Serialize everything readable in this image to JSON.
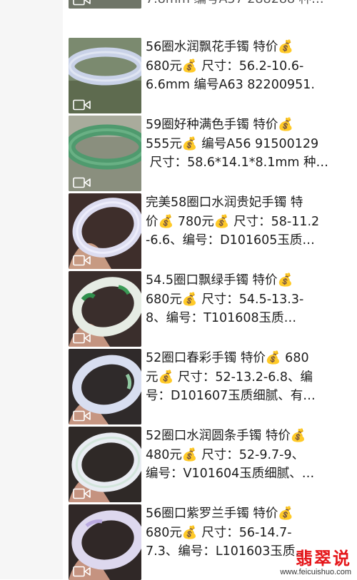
{
  "feed": {
    "top_partial_text": "7.8mm 编号A57 288288 种…",
    "items": [
      {
        "lines": [
          "56圈水润飘花手镯 特价💰",
          "680元💰 尺寸：56.2-10.6-",
          "6.6mm 编号A63 82200951."
        ],
        "thumb_bg": "#7b8a6f",
        "bangle_color": "#c9d2e8"
      },
      {
        "lines": [
          "59圈好种满色手镯 特价💰",
          "555元💰 编号A56 91500129",
          " 尺寸：58.6*14.1*8.1mm 种…"
        ],
        "thumb_bg": "#8a8f7e",
        "bangle_color": "#4f9a6e"
      },
      {
        "lines": [
          "完美58圈口水润贵妃手镯 特",
          "价💰 780元💰 尺寸：58-11.2",
          "-6.6、编号：D101605玉质…"
        ],
        "thumb_bg": "#3e2e2b",
        "bangle_color": "#dcdcf0"
      },
      {
        "lines": [
          "54.5圈口飘绿手镯 特价💰",
          "680元💰 尺寸：54.5-13.3-",
          "8、编号：T101608玉质…"
        ],
        "thumb_bg": "#3a2e2c",
        "bangle_color": "#e6ece4"
      },
      {
        "lines": [
          "52圈口春彩手镯 特价💰 680",
          "元💰 尺寸：52-13.2-6.8、编",
          "号：D101607玉质细腻、有…"
        ],
        "thumb_bg": "#2f2a2a",
        "bangle_color": "#d8def0"
      },
      {
        "lines": [
          "52圈口水润圆条手镯 特价💰",
          "480元💰 尺寸：52-9.7-9、",
          "编号：V101604玉质细腻、…"
        ],
        "thumb_bg": "#2f2927",
        "bangle_color": "#e9ecf2"
      },
      {
        "lines": [
          "56圈口紫罗兰手镯 特价💰",
          "680元💰 尺寸：56-14.7-",
          "7.3、编号：L101603玉质…"
        ],
        "thumb_bg": "#302827",
        "bangle_color": "#ddd8ee"
      }
    ]
  },
  "watermark": {
    "title": "翡翠说",
    "url": "www.feicuishuo.com"
  },
  "colors": {
    "watermark_red": "#e5171b",
    "text": "#1d1d1d"
  }
}
